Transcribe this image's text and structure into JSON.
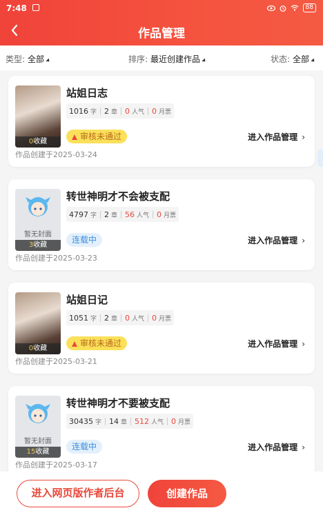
{
  "status": {
    "time": "7:48",
    "battery": "88"
  },
  "header": {
    "title": "作品管理"
  },
  "filters": [
    {
      "label": "类型:",
      "value": "全部"
    },
    {
      "label": "排序:",
      "value": "最近创建作品"
    },
    {
      "label": "状态:",
      "value": "全部"
    }
  ],
  "works": [
    {
      "title": "站姐日志",
      "words": "1016",
      "word_unit": "字",
      "chapters": "2",
      "chapter_unit": "章",
      "popularity": "0",
      "pop_unit": "人气",
      "tickets": "0",
      "ticket_unit": "月票",
      "favorites": "0",
      "fav_unit": "收藏",
      "status": "审核未通过",
      "cover_text": "",
      "manage_label": "进入作品管理",
      "created": "作品创建于2025-03-24"
    },
    {
      "title": "转世神明才不会被支配",
      "words": "4797",
      "word_unit": "字",
      "chapters": "2",
      "chapter_unit": "章",
      "popularity": "56",
      "pop_unit": "人气",
      "tickets": "0",
      "ticket_unit": "月票",
      "favorites": "3",
      "fav_unit": "收藏",
      "status": "连载中",
      "cover_text": "暂无封面",
      "manage_label": "进入作品管理",
      "created": "作品创建于2025-03-23"
    },
    {
      "title": "站姐日记",
      "words": "1051",
      "word_unit": "字",
      "chapters": "2",
      "chapter_unit": "章",
      "popularity": "0",
      "pop_unit": "人气",
      "tickets": "0",
      "ticket_unit": "月票",
      "favorites": "0",
      "fav_unit": "收藏",
      "status": "审核未通过",
      "cover_text": "",
      "manage_label": "进入作品管理",
      "created": "作品创建于2025-03-21"
    },
    {
      "title": "转世神明才不要被支配",
      "words": "30435",
      "word_unit": "字",
      "chapters": "14",
      "chapter_unit": "章",
      "popularity": "512",
      "pop_unit": "人气",
      "tickets": "0",
      "ticket_unit": "月票",
      "favorites": "15",
      "fav_unit": "收藏",
      "status": "连载中",
      "cover_text": "暂无封面",
      "manage_label": "进入作品管理",
      "created": "作品创建于2025-03-17"
    }
  ],
  "bottom": {
    "web_backend": "进入网页版作者后台",
    "create": "创建作品"
  },
  "colors": {
    "accent": "#f0433a",
    "ongoing": "#3d8fe0",
    "fail_bg": "#fbe05a"
  }
}
